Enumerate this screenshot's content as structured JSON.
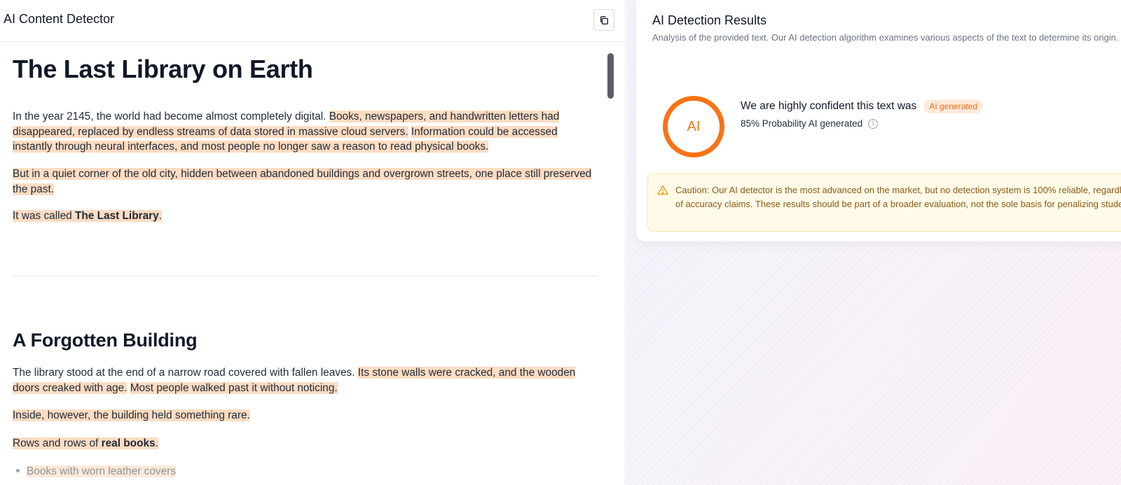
{
  "app": {
    "title": "AI Content Detector"
  },
  "document": {
    "h1": "The Last Library on Earth",
    "intro": {
      "p1_plain": "In the year 2145, the world had become almost completely digital. ",
      "p1_hl1": "Books, newspapers, and handwritten letters had disappeared, replaced by endless streams of data stored in massive cloud servers.",
      "p1_plain2": " ",
      "p1_hl2": "Information could be accessed instantly through neural interfaces, and most people no longer saw a reason to read physical books.",
      "p2_hl": "But in a quiet corner of the old city, hidden between abandoned buildings and overgrown streets, one place still preserved the past.",
      "p3_pre": "It was called ",
      "p3_bold": "The Last Library",
      "p3_post": "."
    },
    "h2": "A Forgotten Building",
    "section2": {
      "p1_plain": "The library stood at the end of a narrow road covered with fallen leaves. ",
      "p1_hl1": "Its stone walls were cracked, and the wooden doors creaked with age.",
      "p1_plain2": " ",
      "p1_hl2": "Most people walked past it without noticing.",
      "p2_hl": "Inside, however, the building held something rare.",
      "p3_pre": "Rows and rows of ",
      "p3_bold": "real books",
      "p3_post": ".",
      "bullets": [
        "Books with worn leather covers"
      ]
    }
  },
  "results": {
    "title": "AI Detection Results",
    "subtitle": "Analysis of the provided text. Our AI detection algorithm examines various aspects of the text to determine its origin.",
    "ring_label": "AI",
    "confidence_pre": "We are ",
    "confidence_strong": "highly confident",
    "confidence_post": " this text was",
    "badge": "AI generated",
    "probability": "85% Probability AI generated",
    "caution": "Caution: Our AI detector is the most advanced on the market, but no detection system is 100% reliable, regardless of accuracy claims. These results should be part of a broader evaluation, not the sole basis for penalizing students."
  },
  "colors": {
    "accent": "#f97316",
    "highlight": "#fddcc2",
    "caution_bg": "#fffbe8"
  },
  "icons": {
    "copy": "copy-icon",
    "info": "info-icon",
    "warning": "warning-icon"
  }
}
